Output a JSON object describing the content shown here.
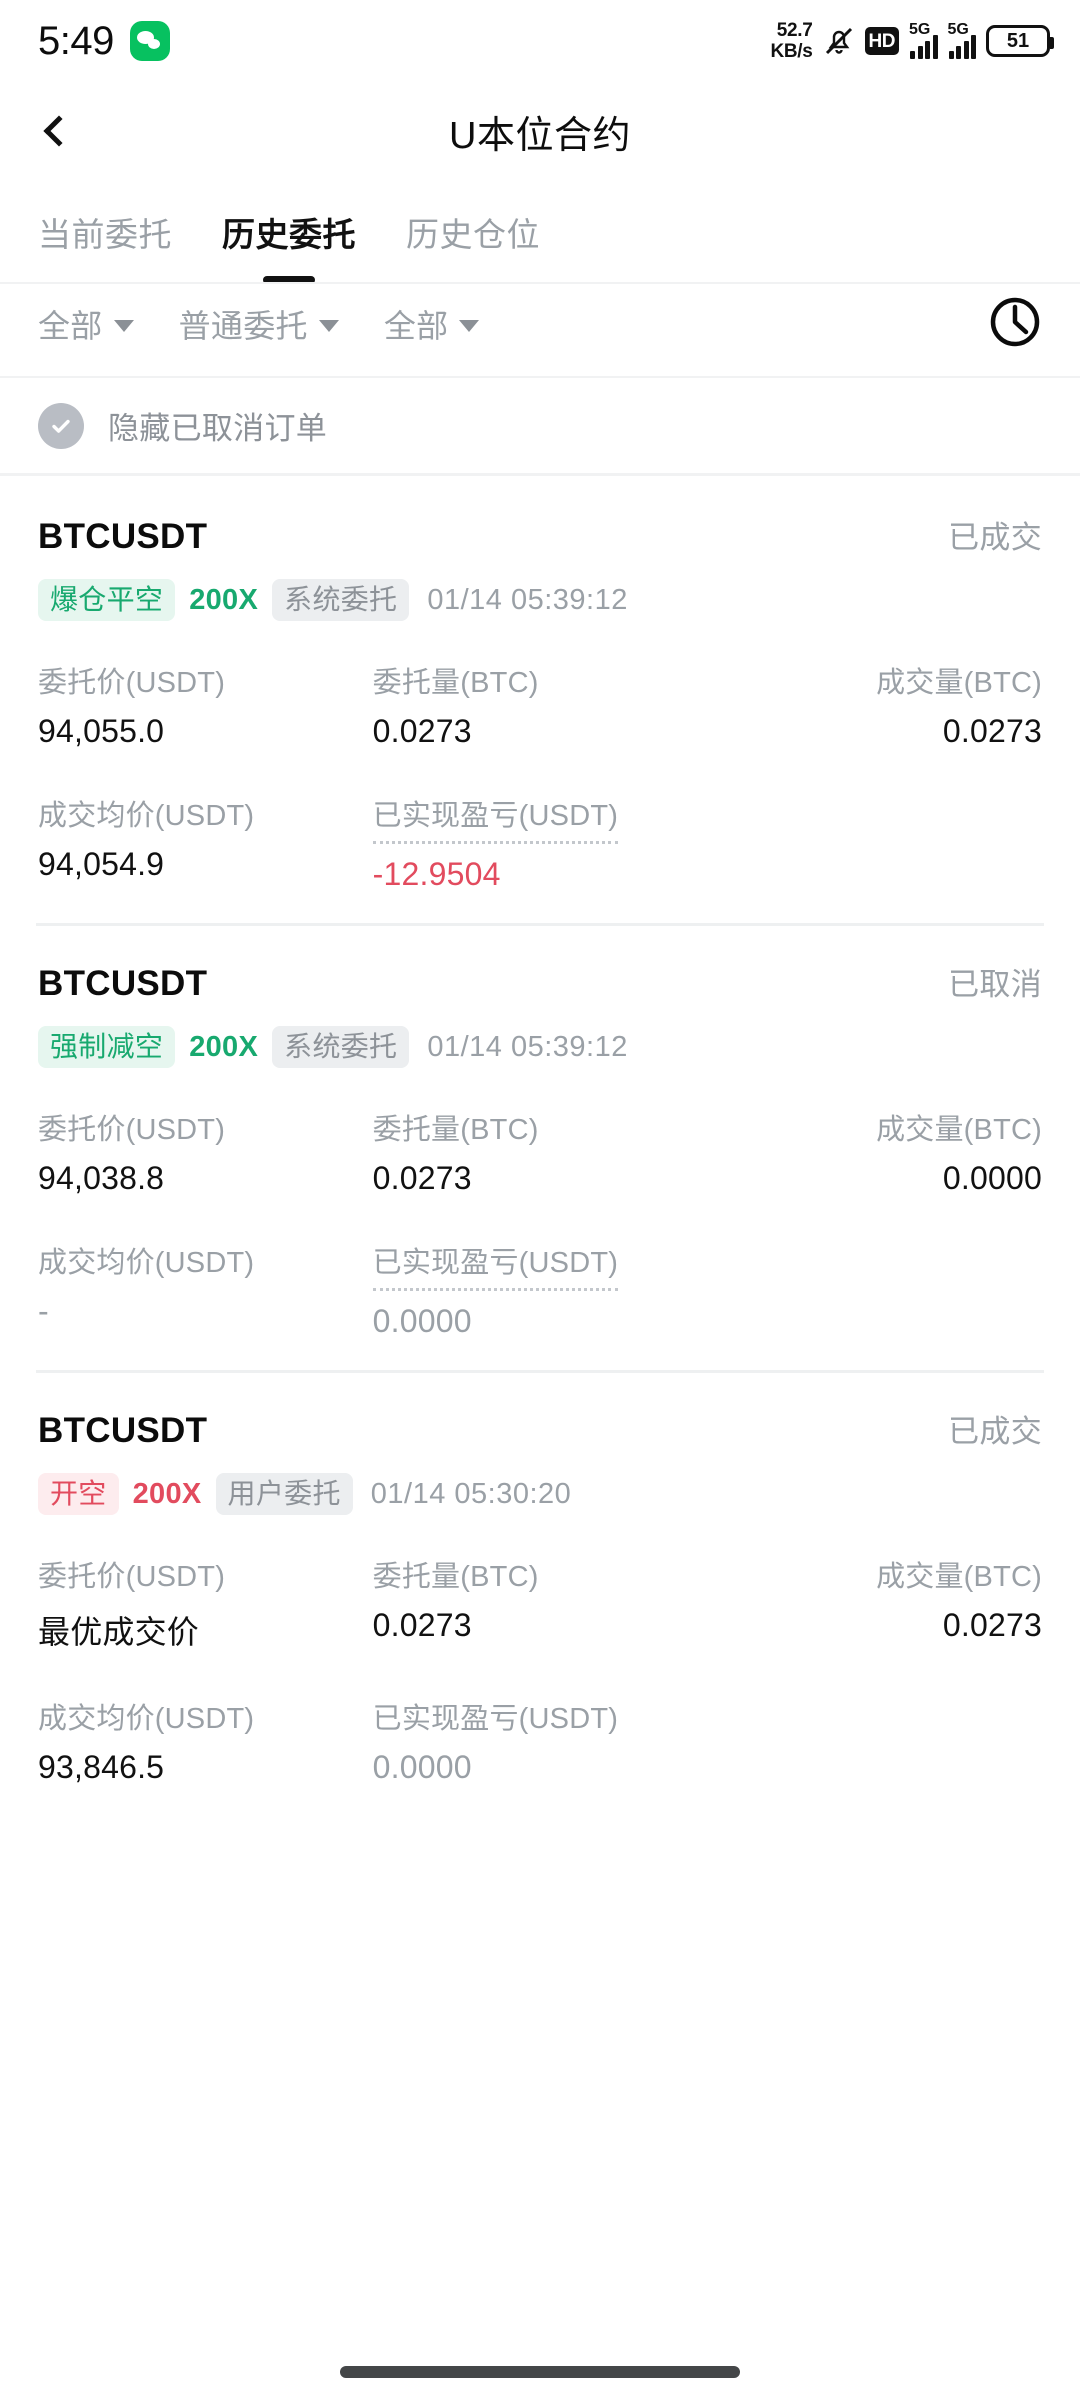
{
  "status_bar": {
    "time": "5:49",
    "app_icon": "wechat-icon",
    "network_speed": "52.7",
    "network_speed_unit": "KB/s",
    "mute_icon": "bell-muted-icon",
    "hd_label": "HD",
    "signal_1_label": "5G",
    "signal_2_label": "5G",
    "battery_level": "51"
  },
  "header": {
    "back_icon": "back-chevron-icon",
    "title": "U本位合约"
  },
  "tabs": [
    {
      "label": "当前委托",
      "active": false
    },
    {
      "label": "历史委托",
      "active": true
    },
    {
      "label": "历史仓位",
      "active": false
    }
  ],
  "filters": [
    {
      "label": "全部"
    },
    {
      "label": "普通委托"
    },
    {
      "label": "全部"
    }
  ],
  "history_icon": "clock-icon",
  "hide_cancelled": {
    "label": "隐藏已取消订单",
    "checked": true,
    "icon": "check-circle-icon"
  },
  "column_labels": {
    "order_price": "委托价(USDT)",
    "order_qty": "委托量(BTC)",
    "filled_qty": "成交量(BTC)",
    "avg_price": "成交均价(USDT)",
    "realized_pnl": "已实现盈亏(USDT)"
  },
  "orders": [
    {
      "symbol": "BTCUSDT",
      "status": "已成交",
      "side_badge": "爆仓平空",
      "side_color": "green",
      "leverage": "200X",
      "order_type": "系统委托",
      "timestamp": "01/14 05:39:12",
      "order_price": "94,055.0",
      "order_qty": "0.0273",
      "filled_qty": "0.0273",
      "avg_price": "94,054.9",
      "realized_pnl": "-12.9504",
      "pnl_color": "negative",
      "avg_price_muted": false,
      "pnl_dotted": true
    },
    {
      "symbol": "BTCUSDT",
      "status": "已取消",
      "side_badge": "强制减空",
      "side_color": "green",
      "leverage": "200X",
      "order_type": "系统委托",
      "timestamp": "01/14 05:39:12",
      "order_price": "94,038.8",
      "order_qty": "0.0273",
      "filled_qty": "0.0000",
      "avg_price": "-",
      "realized_pnl": "0.0000",
      "pnl_color": "muted",
      "avg_price_muted": true,
      "pnl_dotted": true
    },
    {
      "symbol": "BTCUSDT",
      "status": "已成交",
      "side_badge": "开空",
      "side_color": "red",
      "leverage": "200X",
      "order_type": "用户委托",
      "timestamp": "01/14 05:30:20",
      "order_price": "最优成交价",
      "order_qty": "0.0273",
      "filled_qty": "0.0273",
      "avg_price": "93,846.5",
      "realized_pnl": "0.0000",
      "pnl_color": "muted",
      "avg_price_muted": false,
      "pnl_dotted": false
    }
  ],
  "colors": {
    "green": "#18a96f",
    "red": "#e24b5e",
    "muted": "#9aa0a6",
    "text": "#111111",
    "divider": "#eef0f1",
    "badge_green_bg": "#e6f6ef",
    "badge_red_bg": "#fdecee",
    "badge_gray_bg": "#eceef0"
  },
  "home_indicator": "home-indicator"
}
